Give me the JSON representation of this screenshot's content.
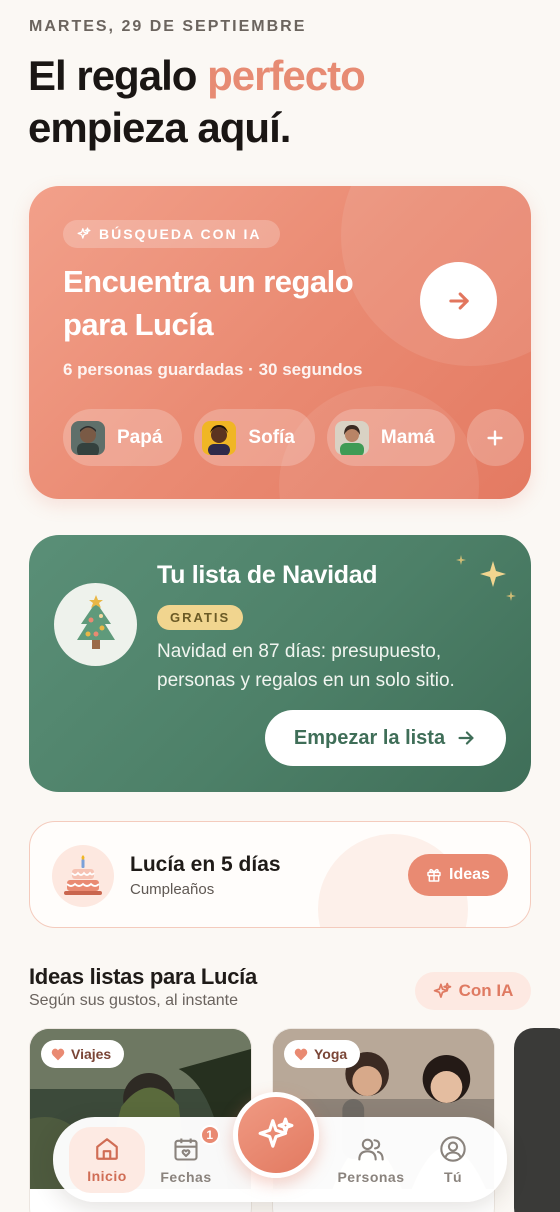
{
  "header": {
    "date": "MARTES, 29 DE SEPTIEMBRE",
    "headline_part1": "El regalo ",
    "headline_accent": "perfecto",
    "headline_part2": "empieza aquí."
  },
  "hero": {
    "badge": "BÚSQUEDA CON IA",
    "title": "Encuentra un regalo para Lucía",
    "subtitle": "6 personas guardadas · 30 segundos",
    "chips": [
      {
        "label": "Papá"
      },
      {
        "label": "Sofía"
      },
      {
        "label": "Mamá"
      }
    ]
  },
  "xmas": {
    "title": "Tu lista de Navidad",
    "badge": "GRATIS",
    "description": "Navidad en 87 días: presupuesto, personas y regalos en un solo sitio.",
    "button": "Empezar la lista"
  },
  "birthday": {
    "title": "Lucía en 5 días",
    "kind": "Cumpleaños",
    "button": "Ideas"
  },
  "ideas_section": {
    "title": "Ideas listas para Lucía",
    "subtitle": "Según sus gustos, al instante",
    "ai_button": "Con IA",
    "cards": [
      {
        "tag": "Viajes"
      },
      {
        "tag": "Yoga"
      }
    ]
  },
  "nav": {
    "items": [
      {
        "label": "Inicio"
      },
      {
        "label": "Fechas",
        "badge": "1"
      },
      {
        "label": "Personas"
      },
      {
        "label": "Tú"
      }
    ]
  },
  "colors": {
    "accent": "#e78b73",
    "green": "#4d8068",
    "gold": "#f1d58f"
  }
}
